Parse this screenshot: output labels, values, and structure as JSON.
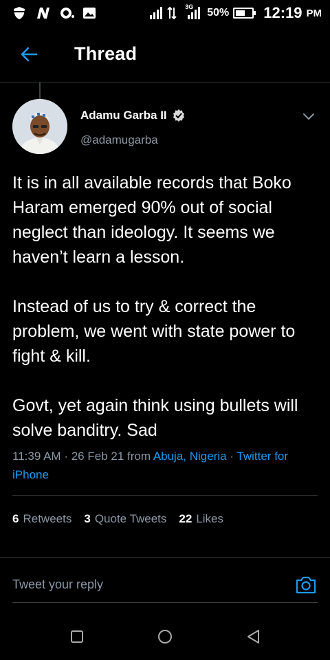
{
  "status_bar": {
    "battery": "50%",
    "time": "12:19",
    "ampm": "PM",
    "network": "3G",
    "battery_level": 0.5
  },
  "header": {
    "title": "Thread"
  },
  "author": {
    "name": "Adamu Garba II",
    "handle": "@adamugarba",
    "verified": true
  },
  "tweet": {
    "paragraphs": [
      "It is in all available records that Boko Haram emerged 90% out of social neglect than ideology. It seems we haven’t learn a lesson.",
      "Instead of us to try & correct the problem, we went with state power to fight & kill.",
      "Govt, yet again think using bullets will solve banditry. Sad"
    ],
    "time": "11:39 AM",
    "date": "26 Feb 21",
    "from_word": "from",
    "location": "Abuja, Nigeria",
    "source": "Twitter for iPhone",
    "separator": "·"
  },
  "stats": {
    "retweets_count": "6",
    "retweets_label": "Retweets",
    "quotes_count": "3",
    "quotes_label": "Quote Tweets",
    "likes_count": "22",
    "likes_label": "Likes"
  },
  "reply": {
    "placeholder": "Tweet your reply"
  },
  "colors": {
    "accent": "#1d9bf0",
    "muted": "#8b98a5",
    "divider": "#2f3336"
  }
}
